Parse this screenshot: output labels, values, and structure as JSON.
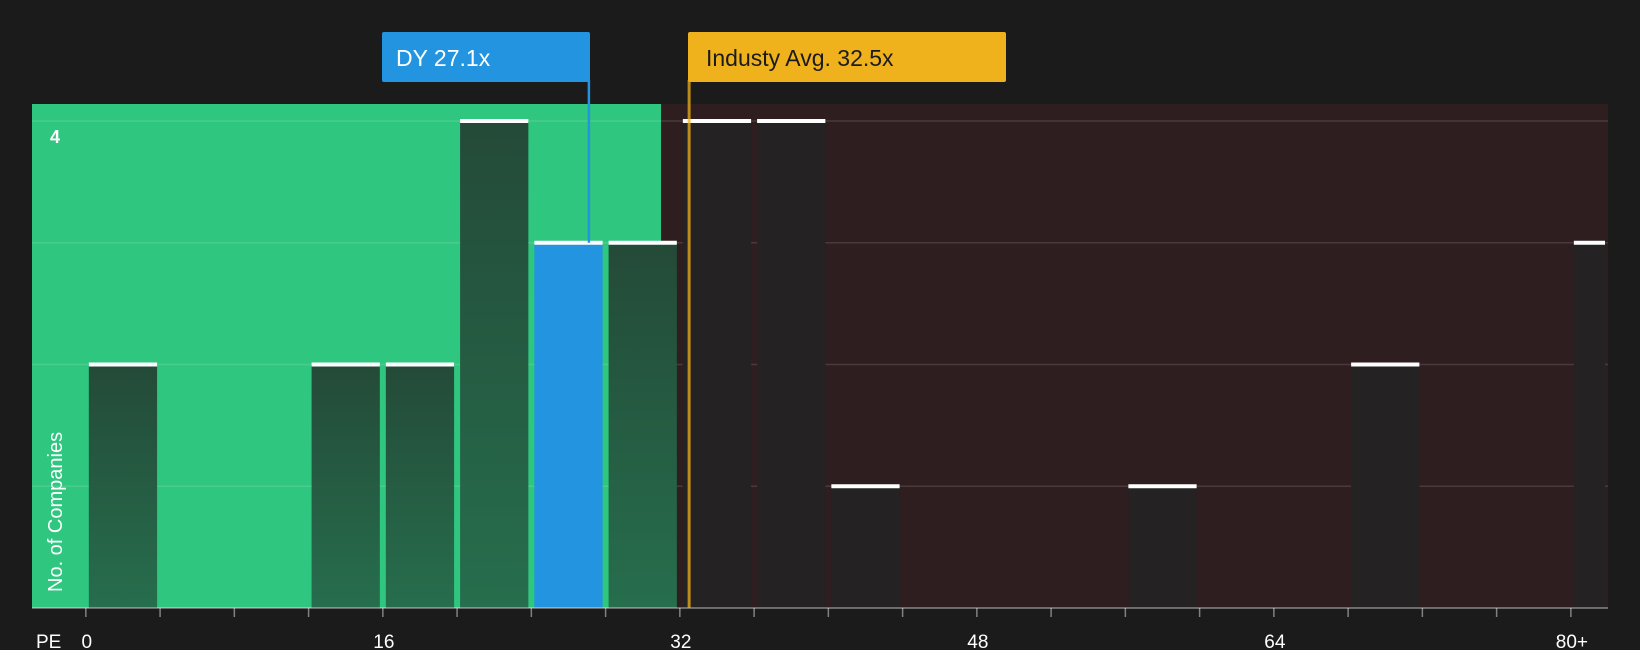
{
  "chart_data": {
    "type": "bar",
    "xaxis_label": "PE",
    "ylabel": "No. of Companies",
    "x_ticks": [
      "0",
      "16",
      "32",
      "48",
      "64",
      "80+"
    ],
    "x_tick_values": [
      0,
      16,
      32,
      48,
      64,
      80
    ],
    "xlim": [
      -2.9,
      82
    ],
    "ylim": [
      0,
      4
    ],
    "y_tick_labels": [
      {
        "value": 4,
        "label": "4"
      }
    ],
    "bin_width": 4,
    "bars": [
      {
        "start": 0,
        "end": 4,
        "count": 2
      },
      {
        "start": 12,
        "end": 16,
        "count": 2
      },
      {
        "start": 16,
        "end": 20,
        "count": 2
      },
      {
        "start": 20,
        "end": 24,
        "count": 4
      },
      {
        "start": 24,
        "end": 28,
        "count": 3,
        "highlight": true
      },
      {
        "start": 28,
        "end": 32,
        "count": 3
      },
      {
        "start": 32,
        "end": 36,
        "count": 4
      },
      {
        "start": 36,
        "end": 40,
        "count": 4
      },
      {
        "start": 40,
        "end": 44,
        "count": 1
      },
      {
        "start": 56,
        "end": 60,
        "count": 1
      },
      {
        "start": 68,
        "end": 72,
        "count": 2
      },
      {
        "start": 80,
        "end": 82,
        "count": 3
      }
    ],
    "company_marker": {
      "label": "DY 27.1x",
      "value": 27.1,
      "color": "#2394e0"
    },
    "industry_marker": {
      "label": "Industy Avg. 32.5x",
      "value": 32.5,
      "color": "#efb21d"
    },
    "colors": {
      "background": "#1b1b1b",
      "undervalued_zone": "#2fc67f",
      "overvalued_zone": "#2e1e1f",
      "bar_in_green": "#244a38",
      "bar_in_red": "#242222",
      "highlight_bar": "#2394e0",
      "bar_cap": "#ffffff"
    }
  }
}
